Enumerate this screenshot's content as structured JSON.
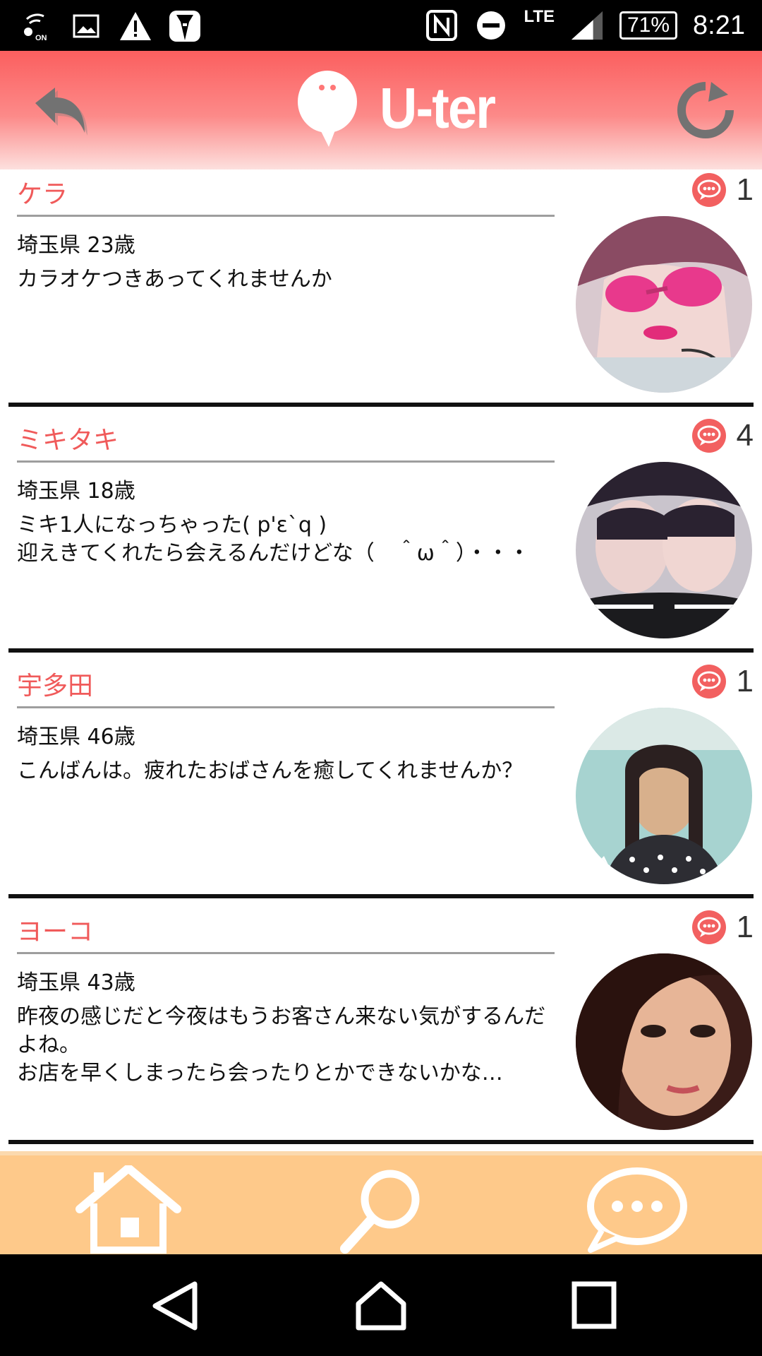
{
  "status_bar": {
    "left_icons": [
      "wifi-calling-icon",
      "image-icon",
      "warning-icon",
      "tuxedo-app-icon"
    ],
    "right_icons": [
      "nfc-icon",
      "do-not-disturb-icon"
    ],
    "network": "LTE",
    "battery": "71%",
    "time": "8:21"
  },
  "header": {
    "logo_text": "U-ter",
    "back_icon": "back-arrow-icon",
    "refresh_icon": "refresh-icon",
    "gradient_top": "#fb5f5f",
    "gradient_bottom": "#fde0de"
  },
  "messages": [
    {
      "name": "ケラ",
      "meta": "埼玉県 23歳",
      "text": "カラオケつきあってくれませんか",
      "count": "1",
      "avatar": "pink-sunglasses-photo"
    },
    {
      "name": "ミキタキ",
      "meta": "埼玉県 18歳",
      "text": "ミキ1人になっちゃった( p'ε`q )\n迎えきてくれたら会えるんだけどな（　＾ω＾）・・・",
      "count": "4",
      "avatar": "two-girls-photo"
    },
    {
      "name": "宇多田",
      "meta": "埼玉県 46歳",
      "text": "こんばんは。疲れたおばさんを癒してくれませんか？",
      "count": "1",
      "avatar": "woman-polka-dot-photo"
    },
    {
      "name": "ヨーコ",
      "meta": "埼玉県 43歳",
      "text": "昨夜の感じだと今夜はもうお客さん来ない気がするんだよね。\nお店を早くしまったら会ったりとかできないかな…",
      "count": "1",
      "avatar": "woman-closeup-photo"
    }
  ],
  "tabbar": {
    "tabs": [
      "home-icon",
      "search-icon",
      "chat-icon"
    ],
    "background": "#fec98a"
  },
  "navbar": {
    "buttons": [
      "back-triangle-icon",
      "home-circle-icon",
      "recents-square-icon"
    ]
  },
  "colors": {
    "name_accent": "#f05a5a",
    "badge": "#f26060"
  }
}
